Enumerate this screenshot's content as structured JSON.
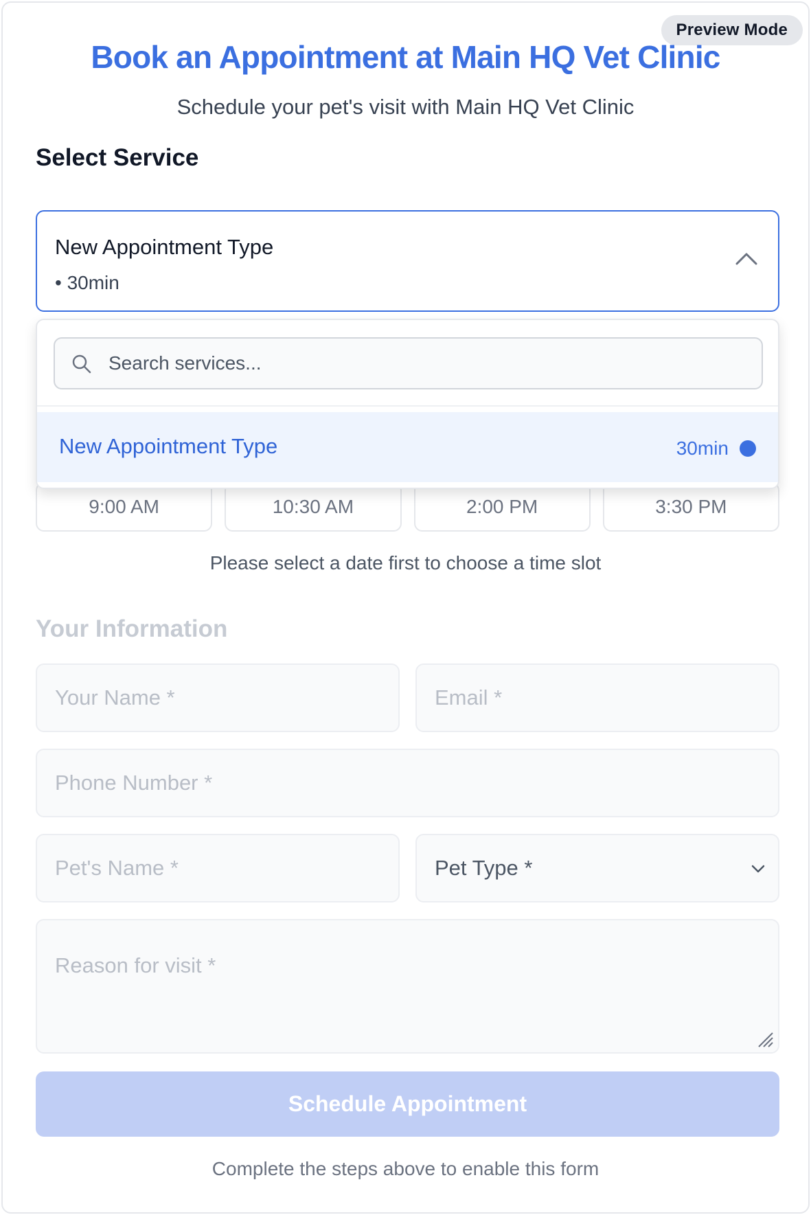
{
  "badge": {
    "label": "Preview Mode"
  },
  "header": {
    "title": "Book an Appointment at Main HQ Vet Clinic",
    "subtitle": "Schedule your pet's visit with Main HQ Vet Clinic"
  },
  "service_section": {
    "label": "Select Service",
    "selected": {
      "name": "New Appointment Type",
      "duration": "• 30min"
    },
    "expanded": true,
    "dropdown": {
      "search_placeholder": "Search services...",
      "search_value": "",
      "options": [
        {
          "name": "New Appointment Type",
          "duration": "30min",
          "selected": true
        }
      ]
    }
  },
  "time_section": {
    "slots": [
      "9:00 AM",
      "10:30 AM",
      "2:00 PM",
      "3:30 PM"
    ],
    "hint": "Please select a date first to choose a time slot"
  },
  "info_section": {
    "label": "Your Information",
    "fields": {
      "name": "Your Name *",
      "email": "Email *",
      "phone": "Phone Number *",
      "pet_name": "Pet's Name *",
      "pet_type": "Pet Type *",
      "reason": "Reason for visit *"
    }
  },
  "submit": {
    "label": "Schedule Appointment",
    "disabled": true,
    "hint": "Complete the steps above to enable this form"
  },
  "colors": {
    "accent": "#3b6fe0",
    "accent_disabled": "#c0cef5",
    "option_highlight": "#eef4fe",
    "border": "#e5e7eb"
  },
  "icons": {
    "service_chevron": "chevron-up-icon",
    "search": "search-icon",
    "pet_type_caret": "chevron-down-icon",
    "resize": "resize-handle-icon",
    "selected_dot": "selected-dot-icon"
  }
}
